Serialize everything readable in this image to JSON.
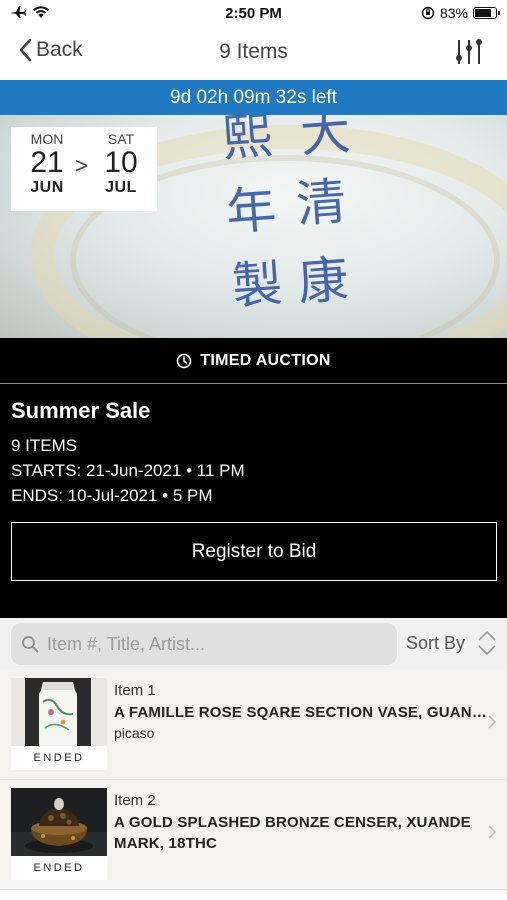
{
  "status_bar": {
    "time": "2:50 PM",
    "battery_text": "83%",
    "battery_level": 0.83
  },
  "nav": {
    "back_label": "Back",
    "title": "9 Items"
  },
  "countdown": {
    "text": "9d 02h 09m 32s left",
    "color": "#1f7ac3"
  },
  "hero": {
    "marks": [
      "大",
      "清",
      "康",
      "熙",
      "年",
      "製"
    ],
    "dates": {
      "start": {
        "dow": "MON",
        "day": "21",
        "month": "JUN"
      },
      "separator": ">",
      "end": {
        "dow": "SAT",
        "day": "10",
        "month": "JUL"
      }
    }
  },
  "auction": {
    "type": "TIMED AUCTION",
    "title": "Summer Sale",
    "items_count": "9 ITEMS",
    "starts": "STARTS: 21-Jun-2021 • 11 PM",
    "ends": "ENDS: 10-Jul-2021 • 5 PM",
    "register_label": "Register to Bid"
  },
  "search": {
    "placeholder": "Item #, Title, Artist...",
    "sort_label": "Sort By"
  },
  "items": [
    {
      "number": "Item 1",
      "title": "A FAMILLE ROSE SQARE SECTION VASE, GUANGXU MARK",
      "artist": "picaso",
      "status": "ENDED"
    },
    {
      "number": "Item 2",
      "title": "A  GOLD SPLASHED BRONZE CENSER, XUANDE MARK, 18THC",
      "artist": "",
      "status": "ENDED"
    }
  ]
}
